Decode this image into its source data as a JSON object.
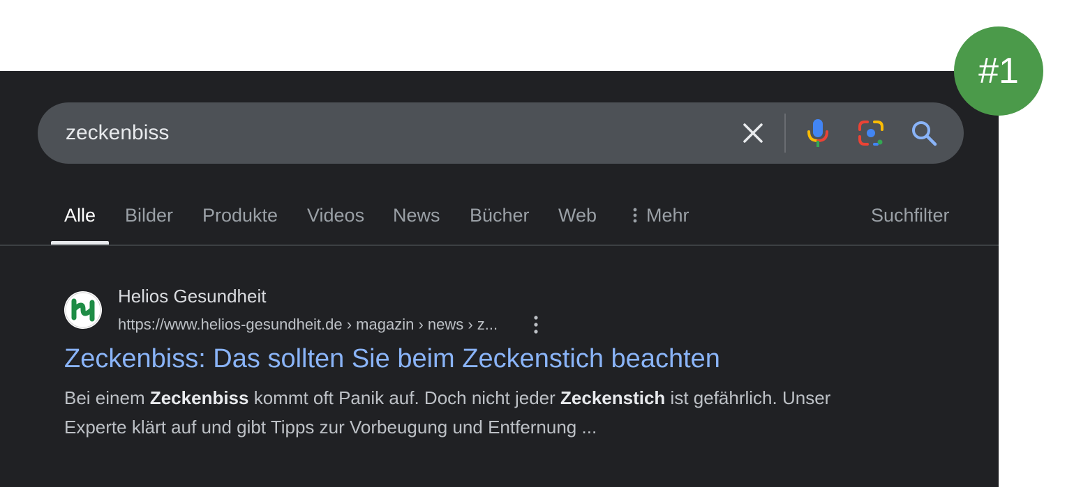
{
  "search": {
    "query": "zeckenbiss"
  },
  "icons": {
    "clear": "close-icon",
    "mic": "microphone-icon",
    "lens": "google-lens-icon",
    "search": "search-icon",
    "more": "more-vert-icon"
  },
  "tabs": [
    {
      "label": "Alle",
      "active": true
    },
    {
      "label": "Bilder"
    },
    {
      "label": "Produkte"
    },
    {
      "label": "Videos"
    },
    {
      "label": "News"
    },
    {
      "label": "Bücher"
    },
    {
      "label": "Web"
    },
    {
      "label": "Mehr"
    }
  ],
  "tools": {
    "filter_label": "Suchfilter"
  },
  "result": {
    "site_name": "Helios Gesundheit",
    "url": "https://www.helios-gesundheit.de › magazin › news › z...",
    "title": "Zeckenbiss: Das sollten Sie beim Zeckenstich beachten",
    "snippet": [
      {
        "text": "Bei einem ",
        "bold": false
      },
      {
        "text": "Zeckenbiss",
        "bold": true
      },
      {
        "text": " kommt oft Panik auf. Doch nicht jeder ",
        "bold": false
      },
      {
        "text": "Zeckenstich",
        "bold": true
      },
      {
        "text": " ist gefährlich. Unser Experte klärt auf und gibt Tipps zur Vorbeugung und Entfernung ...",
        "bold": false
      }
    ]
  },
  "badge": {
    "label": "#1",
    "color": "#4b9a4a"
  },
  "colors": {
    "background": "#202124",
    "searchbar": "#4d5156",
    "link": "#8ab4f8"
  }
}
